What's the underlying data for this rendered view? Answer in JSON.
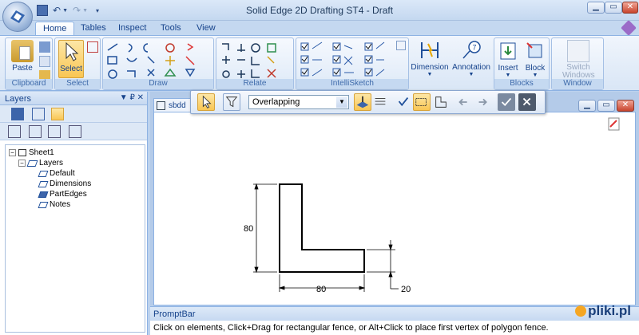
{
  "window": {
    "title": "Solid Edge 2D Drafting ST4 - Draft"
  },
  "tabs": [
    "Home",
    "Tables",
    "Inspect",
    "Tools",
    "View"
  ],
  "groups": {
    "clipboard": "Clipboard",
    "select": "Select",
    "draw": "Draw",
    "relate": "Relate",
    "intellisketch": "IntelliSketch",
    "blocks": "Blocks",
    "window": "Window"
  },
  "buttons": {
    "paste": "Paste",
    "select": "Select",
    "dimension": "Dimension",
    "annotation": "Annotation",
    "insert": "Insert",
    "block": "Block",
    "switch_windows": "Switch Windows"
  },
  "layers_panel": {
    "title": "Layers",
    "pin": "▼ ₽ ✕",
    "tree": {
      "sheet": "Sheet1",
      "layers": "Layers",
      "items": [
        "Default",
        "Dimensions",
        "PartEdges",
        "Notes"
      ]
    }
  },
  "document": {
    "tab": "sbdd"
  },
  "command_bar": {
    "fence_option": "Overlapping"
  },
  "drawing": {
    "dim_height": "80",
    "dim_width": "80",
    "dim_thickness": "20"
  },
  "prompt": {
    "title": "PromptBar",
    "text": "Click on elements, Click+Drag for rectangular fence, or Alt+Click to place first vertex of polygon fence."
  },
  "watermark": "pliki.pl"
}
